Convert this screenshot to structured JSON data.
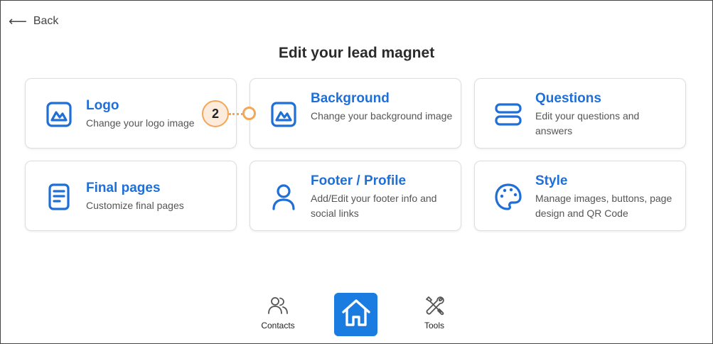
{
  "header": {
    "back_arrow": "⟵",
    "back_label": "Back",
    "title": "Edit your lead magnet"
  },
  "cards": [
    {
      "title": "Logo",
      "description": "Change your logo image",
      "icon": "image-icon"
    },
    {
      "title": "Background",
      "description": "Change your background image",
      "icon": "image-icon"
    },
    {
      "title": "Questions",
      "description": "Edit your questions and answers",
      "icon": "questions-icon"
    },
    {
      "title": "Final pages",
      "description": "Customize final pages",
      "icon": "document-icon"
    },
    {
      "title": "Footer / Profile",
      "description": "Add/Edit your footer info and social links",
      "icon": "user-icon"
    },
    {
      "title": "Style",
      "description": "Manage images, buttons, page design and QR Code",
      "icon": "palette-icon"
    }
  ],
  "callout": {
    "number": "2"
  },
  "bottom_nav": {
    "contacts_label": "Contacts",
    "tools_label": "Tools"
  },
  "colors": {
    "accent": "#1f6fd6",
    "home_button": "#1a7ce0",
    "callout": "#f2a65a"
  }
}
